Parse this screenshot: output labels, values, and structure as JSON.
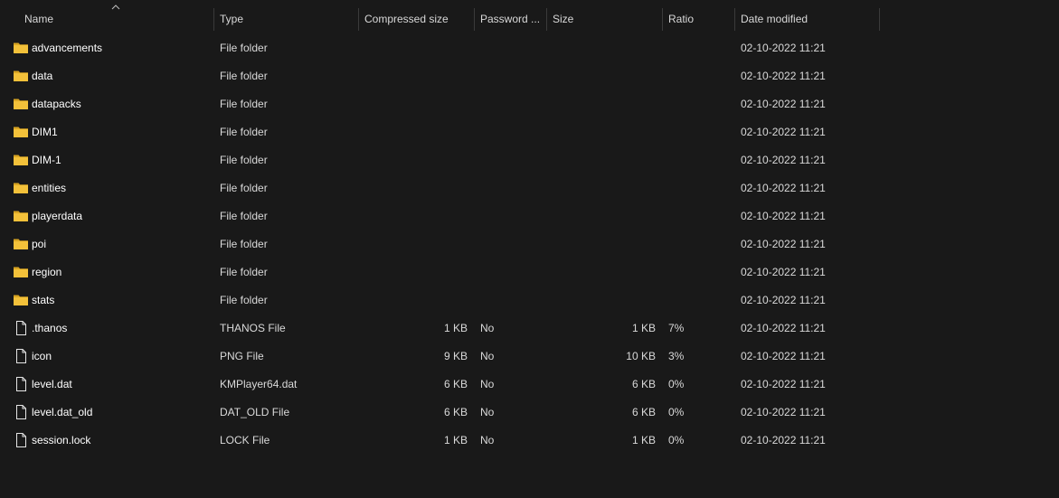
{
  "columns": {
    "name": "Name",
    "type": "Type",
    "compressed_size": "Compressed size",
    "password": "Password ...",
    "size": "Size",
    "ratio": "Ratio",
    "date_modified": "Date modified"
  },
  "sort": {
    "column": "name",
    "direction": "ascending"
  },
  "colors": {
    "background": "#191919",
    "folder": "#f3c13a",
    "folder_dark": "#d9a522",
    "header_text": "#d8d8d8"
  },
  "rows": [
    {
      "icon": "folder-icon",
      "name": "advancements",
      "type": "File folder",
      "compressed_size": "",
      "password": "",
      "size": "",
      "ratio": "",
      "date": "02-10-2022 11:21"
    },
    {
      "icon": "folder-icon",
      "name": "data",
      "type": "File folder",
      "compressed_size": "",
      "password": "",
      "size": "",
      "ratio": "",
      "date": "02-10-2022 11:21"
    },
    {
      "icon": "folder-icon",
      "name": "datapacks",
      "type": "File folder",
      "compressed_size": "",
      "password": "",
      "size": "",
      "ratio": "",
      "date": "02-10-2022 11:21"
    },
    {
      "icon": "folder-icon",
      "name": "DIM1",
      "type": "File folder",
      "compressed_size": "",
      "password": "",
      "size": "",
      "ratio": "",
      "date": "02-10-2022 11:21"
    },
    {
      "icon": "folder-icon",
      "name": "DIM-1",
      "type": "File folder",
      "compressed_size": "",
      "password": "",
      "size": "",
      "ratio": "",
      "date": "02-10-2022 11:21"
    },
    {
      "icon": "folder-icon",
      "name": "entities",
      "type": "File folder",
      "compressed_size": "",
      "password": "",
      "size": "",
      "ratio": "",
      "date": "02-10-2022 11:21"
    },
    {
      "icon": "folder-icon",
      "name": "playerdata",
      "type": "File folder",
      "compressed_size": "",
      "password": "",
      "size": "",
      "ratio": "",
      "date": "02-10-2022 11:21"
    },
    {
      "icon": "folder-icon",
      "name": "poi",
      "type": "File folder",
      "compressed_size": "",
      "password": "",
      "size": "",
      "ratio": "",
      "date": "02-10-2022 11:21"
    },
    {
      "icon": "folder-icon",
      "name": "region",
      "type": "File folder",
      "compressed_size": "",
      "password": "",
      "size": "",
      "ratio": "",
      "date": "02-10-2022 11:21"
    },
    {
      "icon": "folder-icon",
      "name": "stats",
      "type": "File folder",
      "compressed_size": "",
      "password": "",
      "size": "",
      "ratio": "",
      "date": "02-10-2022 11:21"
    },
    {
      "icon": "file-icon",
      "name": ".thanos",
      "type": "THANOS File",
      "compressed_size": "1 KB",
      "password": "No",
      "size": "1 KB",
      "ratio": "7%",
      "date": "02-10-2022 11:21"
    },
    {
      "icon": "file-icon",
      "name": "icon",
      "type": "PNG File",
      "compressed_size": "9 KB",
      "password": "No",
      "size": "10 KB",
      "ratio": "3%",
      "date": "02-10-2022 11:21"
    },
    {
      "icon": "file-icon",
      "name": "level.dat",
      "type": "KMPlayer64.dat",
      "compressed_size": "6 KB",
      "password": "No",
      "size": "6 KB",
      "ratio": "0%",
      "date": "02-10-2022 11:21"
    },
    {
      "icon": "file-icon",
      "name": "level.dat_old",
      "type": "DAT_OLD File",
      "compressed_size": "6 KB",
      "password": "No",
      "size": "6 KB",
      "ratio": "0%",
      "date": "02-10-2022 11:21"
    },
    {
      "icon": "file-icon",
      "name": "session.lock",
      "type": "LOCK File",
      "compressed_size": "1 KB",
      "password": "No",
      "size": "1 KB",
      "ratio": "0%",
      "date": "02-10-2022 11:21"
    }
  ]
}
